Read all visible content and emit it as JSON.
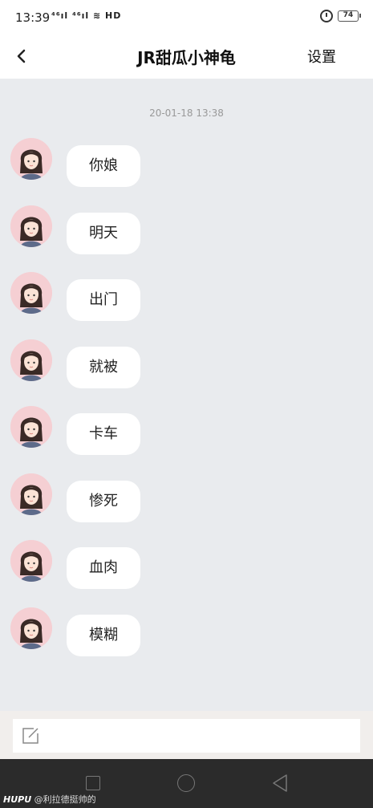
{
  "status_bar": {
    "time": "13:39",
    "network": "⁴⁶ıl ⁴⁶ıl ≋ HD",
    "battery": "74"
  },
  "header": {
    "title": "JR甜瓜小神龟",
    "settings_label": "设置"
  },
  "chat": {
    "timestamp": "20-01-18 13:38",
    "messages": [
      {
        "text": "你娘"
      },
      {
        "text": "明天"
      },
      {
        "text": "出门"
      },
      {
        "text": "就被"
      },
      {
        "text": "卡车"
      },
      {
        "text": "惨死"
      },
      {
        "text": "血肉"
      },
      {
        "text": "模糊"
      }
    ]
  },
  "watermark": {
    "brand": "HUPU",
    "text": "@利拉德挺帅的"
  },
  "colors": {
    "chat_background": "#e9ebee",
    "bubble": "#ffffff",
    "avatar_background": "#f5cfd3",
    "nav_bar": "#2b2b2b"
  }
}
